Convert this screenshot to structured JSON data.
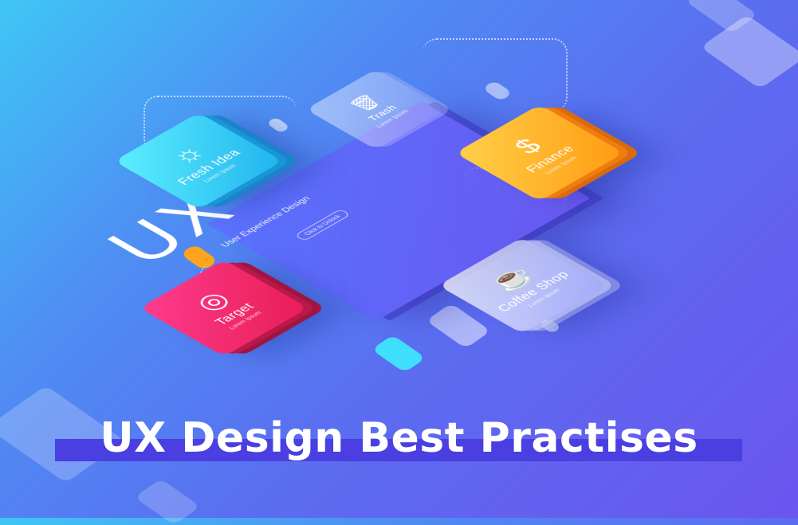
{
  "hero": {
    "title": "UX Design Best Practises"
  },
  "center": {
    "heading": "UX",
    "subtitle": "User Experience Design",
    "button_label": "Click to Unlock"
  },
  "cards": {
    "idea": {
      "title": "Fresh Idea",
      "sub": "Lorem Ipsum",
      "icon": "lightbulb-icon"
    },
    "target": {
      "title": "Target",
      "sub": "Lorem Ipsum",
      "icon": "target-icon"
    },
    "trash": {
      "title": "Trash",
      "sub": "Lorem Ipsum",
      "icon": "trash-icon"
    },
    "finance": {
      "title": "Finance",
      "sub": "Lorem Ipsum",
      "icon": "finance-icon"
    },
    "coffee": {
      "title": "Coffee Shop",
      "sub": "Lorem Ipsum",
      "icon": "coffee-cup-icon"
    }
  },
  "colors": {
    "idea": "#20b4ee",
    "target": "#e81e55",
    "finance": "#ff9c12",
    "background": "#5b6cf0"
  }
}
